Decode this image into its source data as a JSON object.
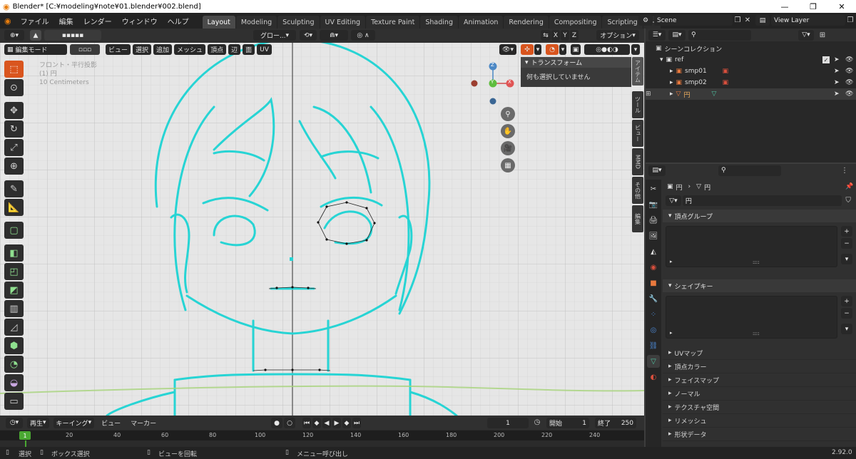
{
  "window": {
    "title": "Blender* [C:¥modeling¥note¥01.blender¥002.blend]",
    "minimize": "—",
    "maximize": "❐",
    "close": "✕"
  },
  "menus": [
    "ファイル",
    "編集",
    "レンダー",
    "ウィンドウ",
    "ヘルプ"
  ],
  "workspaces": [
    "Layout",
    "Modeling",
    "Sculpting",
    "UV Editing",
    "Texture Paint",
    "Shading",
    "Animation",
    "Rendering",
    "Compositing",
    "Scripting"
  ],
  "active_workspace": "Layout",
  "scene": {
    "label": "Scene",
    "view_layer": "View Layer"
  },
  "header": {
    "transform_orientation": "グロー...",
    "axes": [
      "X",
      "Y",
      "Z"
    ],
    "options": "オプション"
  },
  "edit_header": {
    "mode": "編集モード",
    "items": [
      "ビュー",
      "選択",
      "追加",
      "メッシュ",
      "頂点",
      "辺",
      "面",
      "UV"
    ]
  },
  "viewport_info": {
    "line1": "フロント・平行投影",
    "line2": "(1) 円",
    "line3": "10 Centimeters"
  },
  "gizmo": {
    "z": "Z",
    "y": "Y",
    "x": "X"
  },
  "npanel": {
    "title": "トランスフォーム",
    "message": "何も選択していません",
    "tabs": [
      "アイテム",
      "ツール",
      "ビュー",
      "MMD",
      "その他",
      "編集"
    ]
  },
  "timeline": {
    "playback": "再生",
    "keying": "キーイング",
    "view": "ビュー",
    "marker": "マーカー",
    "current_frame": "1",
    "start_label": "開始",
    "start": "1",
    "end_label": "終了",
    "end": "250",
    "ticks": [
      "1",
      "20",
      "40",
      "60",
      "80",
      "100",
      "120",
      "140",
      "160",
      "180",
      "200",
      "220",
      "240"
    ]
  },
  "status": {
    "select": "選択",
    "box_select": "ボックス選択",
    "rotate_view": "ビューを回転",
    "call_menu": "メニュー呼び出し",
    "version": "2.92.0"
  },
  "outliner": {
    "collection": "シーンコレクション",
    "items": [
      {
        "name": "ref",
        "indent": 1
      },
      {
        "name": "smp01",
        "indent": 2
      },
      {
        "name": "smp02",
        "indent": 2
      },
      {
        "name": "円",
        "indent": 2
      }
    ]
  },
  "properties": {
    "object_name": "円",
    "mesh_name": "円",
    "data_field": "円",
    "panels": [
      "頂点グループ",
      "シェイプキー"
    ],
    "collapsed": [
      "UVマップ",
      "頂点カラー",
      "フェイスマップ",
      "ノーマル",
      "テクスチャ空間",
      "リメッシュ",
      "形状データ"
    ]
  },
  "colors": {
    "accent": "#d9551e",
    "blue": "#4772b3",
    "stroke": "#27d4d4",
    "ground": "#a6d37b"
  }
}
